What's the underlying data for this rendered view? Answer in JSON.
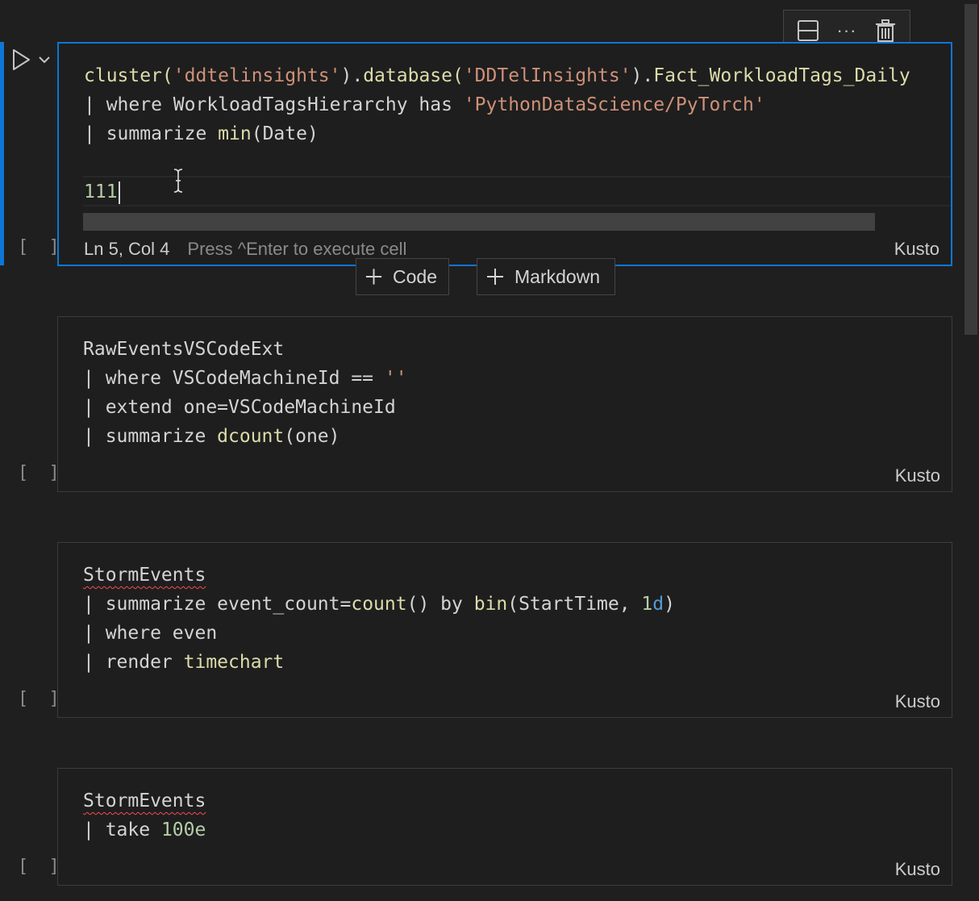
{
  "toolbar": {
    "icons": [
      "split-cell-icon",
      "more-actions-icon",
      "delete-icon"
    ],
    "more_label": "···"
  },
  "cells": [
    {
      "lines": [
        [
          {
            "t": "cluster(",
            "c": "fn"
          },
          {
            "t": "'ddtelinsights'",
            "c": "str"
          },
          {
            "t": ").",
            "c": ""
          },
          {
            "t": "database(",
            "c": "fn"
          },
          {
            "t": "'DDTelInsights'",
            "c": "str"
          },
          {
            "t": ").",
            "c": ""
          },
          {
            "t": "Fact_WorkloadTags_Daily",
            "c": "fn"
          }
        ],
        [
          {
            "t": "| where WorkloadTagsHierarchy has ",
            "c": ""
          },
          {
            "t": "'PythonDataScience/PyTorch'",
            "c": "str"
          }
        ],
        [
          {
            "t": "| summarize ",
            "c": ""
          },
          {
            "t": "min",
            "c": "fn"
          },
          {
            "t": "(Date)",
            "c": ""
          }
        ],
        [],
        [
          {
            "t": "111",
            "c": "num"
          }
        ]
      ],
      "status_position": "Ln 5, Col 4",
      "status_hint": "Press ^Enter to execute cell",
      "language": "Kusto",
      "exec_count": "[ ]"
    },
    {
      "lines": [
        [
          {
            "t": "RawEventsVSCodeExt",
            "c": ""
          }
        ],
        [
          {
            "t": "| where VSCodeMachineId == ",
            "c": ""
          },
          {
            "t": "''",
            "c": "str"
          }
        ],
        [
          {
            "t": "| extend one=VSCodeMachineId",
            "c": ""
          }
        ],
        [
          {
            "t": "| summarize ",
            "c": ""
          },
          {
            "t": "dcount",
            "c": "fn"
          },
          {
            "t": "(one)",
            "c": ""
          }
        ]
      ],
      "language": "Kusto",
      "exec_count": "[ ]"
    },
    {
      "lines": [
        [
          {
            "t": "StormEvents",
            "c": "squiggle"
          }
        ],
        [
          {
            "t": "| summarize event_count=",
            "c": ""
          },
          {
            "t": "count",
            "c": "fn"
          },
          {
            "t": "() by ",
            "c": ""
          },
          {
            "t": "bin",
            "c": "fn"
          },
          {
            "t": "(StartTime, ",
            "c": ""
          },
          {
            "t": "1",
            "c": "num"
          },
          {
            "t": "d",
            "c": "kw-blue"
          },
          {
            "t": ")",
            "c": ""
          }
        ],
        [
          {
            "t": "| where even",
            "c": ""
          }
        ],
        [
          {
            "t": "| render ",
            "c": ""
          },
          {
            "t": "timechart",
            "c": "fn"
          }
        ]
      ],
      "language": "Kusto",
      "exec_count": "[ ]"
    },
    {
      "lines": [
        [
          {
            "t": "StormEvents",
            "c": "squiggle"
          }
        ],
        [
          {
            "t": "| take ",
            "c": ""
          },
          {
            "t": "100e",
            "c": "num"
          }
        ]
      ],
      "language": "Kusto",
      "exec_count": "[ ]"
    }
  ],
  "add_buttons": {
    "code_label": "Code",
    "markdown_label": "Markdown"
  }
}
